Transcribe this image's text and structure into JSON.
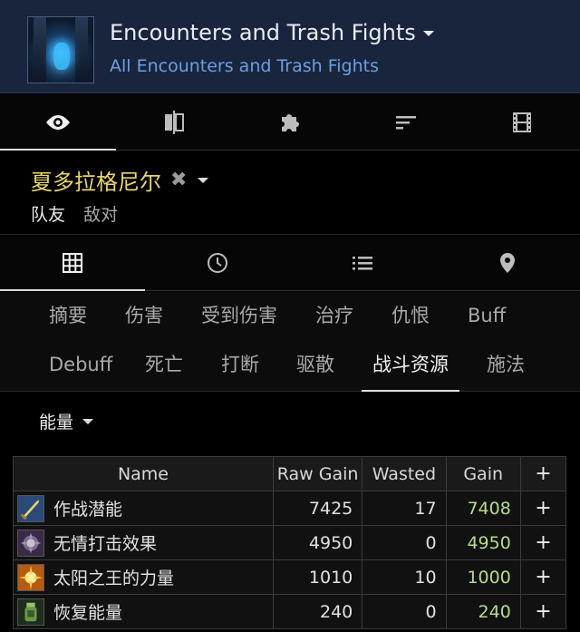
{
  "header": {
    "title": "Encounters and Trash Fights",
    "subtitle": "All Encounters and Trash Fights"
  },
  "main_tabs": [
    {
      "icon": "eye-icon",
      "active": true
    },
    {
      "icon": "compare-icon",
      "active": false
    },
    {
      "icon": "puzzle-icon",
      "active": false
    },
    {
      "icon": "sort-icon",
      "active": false
    },
    {
      "icon": "film-icon",
      "active": false
    }
  ],
  "unit": {
    "name": "夏多拉格尼尔",
    "clear_symbol": "✖",
    "filters": [
      "队友",
      "敌对"
    ],
    "name_color": "#e8d66a"
  },
  "sub_tabs": [
    {
      "icon": "grid-icon",
      "active": true
    },
    {
      "icon": "clock-icon",
      "active": false
    },
    {
      "icon": "list-icon",
      "active": false
    },
    {
      "icon": "map-pin-icon",
      "active": false
    }
  ],
  "categories": [
    "摘要",
    "伤害",
    "受到伤害",
    "治疗",
    "仇恨",
    "Buff",
    "Debuff",
    "死亡",
    "打断",
    "驱散",
    "战斗资源",
    "施法"
  ],
  "active_category": "战斗资源",
  "resource_select": "能量",
  "table": {
    "columns": [
      "Name",
      "Raw Gain",
      "Wasted",
      "Gain",
      "+"
    ],
    "rows": [
      {
        "name": "作战潜能",
        "raw_gain": "7425",
        "wasted": "17",
        "gain": "7408",
        "action": "+",
        "icon": "sword-icon"
      },
      {
        "name": "无情打击效果",
        "raw_gain": "4950",
        "wasted": "0",
        "gain": "4950",
        "action": "+",
        "icon": "ruthless-icon"
      },
      {
        "name": "太阳之王的力量",
        "raw_gain": "1010",
        "wasted": "10",
        "gain": "1000",
        "action": "+",
        "icon": "sunburst-icon"
      },
      {
        "name": "恢复能量",
        "raw_gain": "240",
        "wasted": "0",
        "gain": "240",
        "action": "+",
        "icon": "potion-icon"
      }
    ]
  },
  "colors": {
    "header_bg": "#18253d",
    "subtitle": "#6d9fe0",
    "gain_text": "#b8dc8a"
  }
}
